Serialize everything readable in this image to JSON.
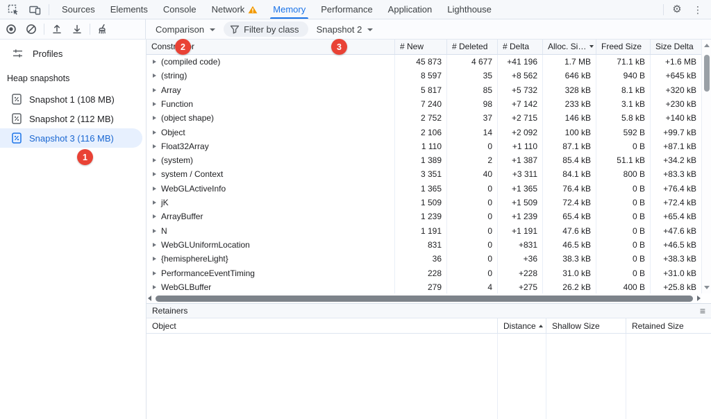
{
  "colors": {
    "accent_blue": "#1a73e8",
    "badge_red": "#e94235",
    "warning_orange": "#f29900",
    "selected_item_bg": "#e7f0fe"
  },
  "tabbar": {
    "tabs": [
      {
        "label": "Sources"
      },
      {
        "label": "Elements"
      },
      {
        "label": "Console"
      },
      {
        "label": "Network"
      },
      {
        "label": "Memory"
      },
      {
        "label": "Performance"
      },
      {
        "label": "Application"
      },
      {
        "label": "Lighthouse"
      }
    ],
    "gear_icon": "⚙",
    "more_icon": "⋮"
  },
  "toolbar": {
    "mode_label": "Comparison",
    "filter_label": "Filter by class",
    "baseline_label": "Snapshot 2"
  },
  "sidebar": {
    "profiles_label": "Profiles",
    "section_label": "Heap snapshots",
    "snapshots": [
      {
        "label": "Snapshot 1 (108 MB)"
      },
      {
        "label": "Snapshot 2 (112 MB)"
      },
      {
        "label": "Snapshot 3 (116 MB)"
      }
    ]
  },
  "badges": {
    "one": "1",
    "two": "2",
    "three": "3"
  },
  "grid": {
    "columns": [
      "Constructor",
      "# New",
      "# Deleted",
      "# Delta",
      "Alloc. Si…",
      "Freed Size",
      "Size Delta"
    ],
    "sorted_by": "Alloc. Si…",
    "rows": [
      {
        "name": "(compiled code)",
        "new": "45 873",
        "deleted": "4 677",
        "delta": "+41 196",
        "alloc": "1.7 MB",
        "freed": "71.1 kB",
        "size": "+1.6 MB"
      },
      {
        "name": "(string)",
        "new": "8 597",
        "deleted": "35",
        "delta": "+8 562",
        "alloc": "646 kB",
        "freed": "940 B",
        "size": "+645 kB"
      },
      {
        "name": "Array",
        "new": "5 817",
        "deleted": "85",
        "delta": "+5 732",
        "alloc": "328 kB",
        "freed": "8.1 kB",
        "size": "+320 kB"
      },
      {
        "name": "Function",
        "new": "7 240",
        "deleted": "98",
        "delta": "+7 142",
        "alloc": "233 kB",
        "freed": "3.1 kB",
        "size": "+230 kB"
      },
      {
        "name": "(object shape)",
        "new": "2 752",
        "deleted": "37",
        "delta": "+2 715",
        "alloc": "146 kB",
        "freed": "5.8 kB",
        "size": "+140 kB"
      },
      {
        "name": "Object",
        "new": "2 106",
        "deleted": "14",
        "delta": "+2 092",
        "alloc": "100 kB",
        "freed": "592 B",
        "size": "+99.7 kB"
      },
      {
        "name": "Float32Array",
        "new": "1 110",
        "deleted": "0",
        "delta": "+1 110",
        "alloc": "87.1 kB",
        "freed": "0 B",
        "size": "+87.1 kB"
      },
      {
        "name": "(system)",
        "new": "1 389",
        "deleted": "2",
        "delta": "+1 387",
        "alloc": "85.4 kB",
        "freed": "51.1 kB",
        "size": "+34.2 kB"
      },
      {
        "name": "system / Context",
        "new": "3 351",
        "deleted": "40",
        "delta": "+3 311",
        "alloc": "84.1 kB",
        "freed": "800 B",
        "size": "+83.3 kB"
      },
      {
        "name": "WebGLActiveInfo",
        "new": "1 365",
        "deleted": "0",
        "delta": "+1 365",
        "alloc": "76.4 kB",
        "freed": "0 B",
        "size": "+76.4 kB"
      },
      {
        "name": "jK",
        "new": "1 509",
        "deleted": "0",
        "delta": "+1 509",
        "alloc": "72.4 kB",
        "freed": "0 B",
        "size": "+72.4 kB"
      },
      {
        "name": "ArrayBuffer",
        "new": "1 239",
        "deleted": "0",
        "delta": "+1 239",
        "alloc": "65.4 kB",
        "freed": "0 B",
        "size": "+65.4 kB"
      },
      {
        "name": "N",
        "new": "1 191",
        "deleted": "0",
        "delta": "+1 191",
        "alloc": "47.6 kB",
        "freed": "0 B",
        "size": "+47.6 kB"
      },
      {
        "name": "WebGLUniformLocation",
        "new": "831",
        "deleted": "0",
        "delta": "+831",
        "alloc": "46.5 kB",
        "freed": "0 B",
        "size": "+46.5 kB"
      },
      {
        "name": "{hemisphereLight}",
        "new": "36",
        "deleted": "0",
        "delta": "+36",
        "alloc": "38.3 kB",
        "freed": "0 B",
        "size": "+38.3 kB"
      },
      {
        "name": "PerformanceEventTiming",
        "new": "228",
        "deleted": "0",
        "delta": "+228",
        "alloc": "31.0 kB",
        "freed": "0 B",
        "size": "+31.0 kB"
      },
      {
        "name": "WebGLBuffer",
        "new": "279",
        "deleted": "4",
        "delta": "+275",
        "alloc": "26.2 kB",
        "freed": "400 B",
        "size": "+25.8 kB"
      }
    ]
  },
  "retainers": {
    "title": "Retainers",
    "menu_icon": "≡",
    "columns": [
      "Object",
      "Distance",
      "Shallow Size",
      "Retained Size"
    ],
    "sorted_by": "Distance"
  }
}
